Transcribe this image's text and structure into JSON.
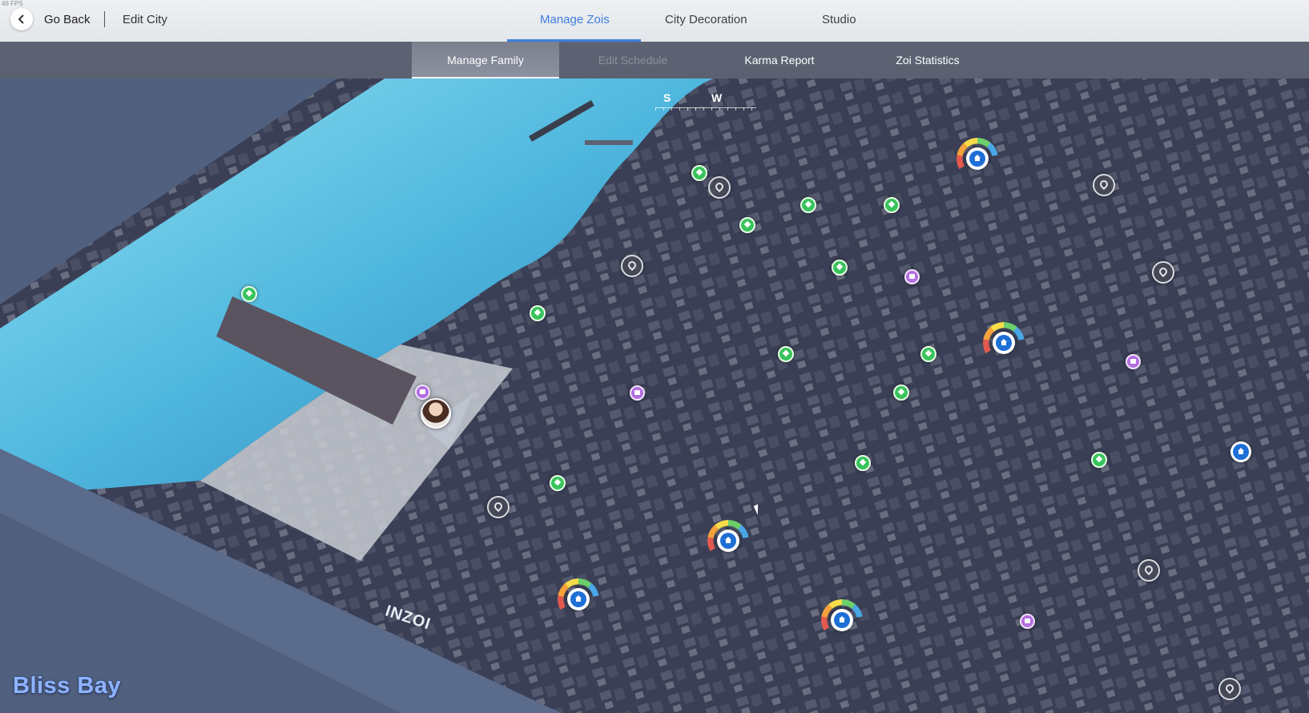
{
  "fps_text": "46 FPS",
  "header": {
    "go_back_label": "Go Back",
    "edit_city_label": "Edit City",
    "tabs": [
      {
        "label": "Manage Zois",
        "active": true
      },
      {
        "label": "City Decoration",
        "active": false
      },
      {
        "label": "Studio",
        "active": false
      }
    ]
  },
  "subnav": {
    "tabs": [
      {
        "label": "Manage Family",
        "active": true,
        "disabled": false
      },
      {
        "label": "Edit Schedule",
        "active": false,
        "disabled": true
      },
      {
        "label": "Karma Report",
        "active": false,
        "disabled": false
      },
      {
        "label": "Zoi Statistics",
        "active": false,
        "disabled": false
      }
    ]
  },
  "compass": {
    "left_label": "S",
    "right_label": "W"
  },
  "map": {
    "city_name": "Bliss Bay",
    "logo_text": "INZOI",
    "colors": {
      "water": "#5fc4e6",
      "sand": "#c9ccd2",
      "ground": "#3a3f55",
      "accent": "#3d7fe0"
    }
  },
  "markers": {
    "green": [
      "activity-pin"
    ],
    "purple": [
      "event-pin"
    ],
    "grey": [
      "empty-lot-pin"
    ],
    "home": [
      "household-home-pin"
    ],
    "blue": [
      "home-pin"
    ]
  },
  "icons": {
    "back": "chevron-left-icon",
    "house": "house-icon"
  }
}
